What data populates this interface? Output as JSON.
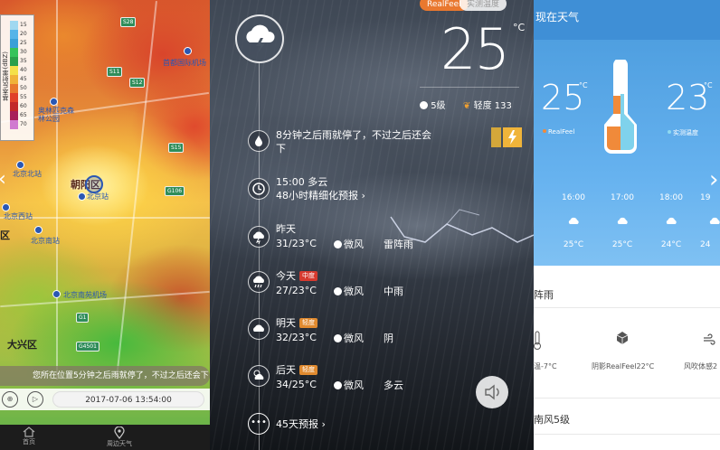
{
  "radar": {
    "legend_title": "基本反射率(dBZ)",
    "legend_values": [
      "15",
      "20",
      "25",
      "30",
      "35",
      "40",
      "45",
      "50",
      "55",
      "60",
      "65",
      "70"
    ],
    "legend_colors": [
      "#a0d8f0",
      "#55b4e8",
      "#3aa0d8",
      "#35c35a",
      "#2aa04a",
      "#f4e04a",
      "#f0b23a",
      "#e8782f",
      "#e0402a",
      "#c2282a",
      "#a8205a",
      "#d07ad0"
    ],
    "labels": {
      "chaoyang": "朝阳区",
      "beijing_north": "北京北站",
      "beijing_station": "北京站",
      "beijing_west": "北京西站",
      "beijing_south": "北京南站",
      "nanyuan": "北京南苑机场",
      "daxing": "大兴区",
      "olympic": "奥林匹克森林公园",
      "capital": "首都国际机场",
      "area_left": "区"
    },
    "roads": [
      "S28",
      "S11",
      "S12",
      "S15",
      "G1",
      "G106",
      "G4501"
    ],
    "message": "您所在位置5分钟之后雨就停了，不过之后还会下",
    "timestamp": "2017-07-06 13:54:00",
    "tabs": [
      "首页",
      "周边天气"
    ]
  },
  "forecast": {
    "realfeel_label": "RealFeel",
    "measured_label": "实测温度",
    "temperature": "25",
    "unit": "°C",
    "wind_level": "5级",
    "aqi_label": "轻度 133",
    "alert_text": "8分钟之后雨就停了，不过之后还会下",
    "hourly_time": "15:00  多云",
    "hourly_link": "48小时精细化预报",
    "days": [
      {
        "name": "昨天",
        "badge": "",
        "temps": "31/23°C",
        "wind": "微风",
        "cond": "雷阵雨"
      },
      {
        "name": "今天",
        "badge": "中度",
        "badge_color": "#d63a2f",
        "temps": "27/23°C",
        "wind": "微风",
        "cond": "中雨"
      },
      {
        "name": "明天",
        "badge": "轻度",
        "badge_color": "#e08a2f",
        "temps": "32/23°C",
        "wind": "微风",
        "cond": "阴"
      },
      {
        "name": "后天",
        "badge": "轻度",
        "badge_color": "#e08a2f",
        "temps": "34/25°C",
        "wind": "微风",
        "cond": "多云"
      }
    ],
    "days45_link": "45天预报"
  },
  "detail": {
    "header": "现在天气",
    "realfeel_temp": "25",
    "realfeel_label": "RealFeel",
    "measured_temp": "23",
    "measured_label": "实测温度",
    "deg": "°C",
    "hours": [
      {
        "time": "16:00",
        "temp": "25°C"
      },
      {
        "time": "17:00",
        "temp": "25°C"
      },
      {
        "time": "18:00",
        "temp": "24°C"
      },
      {
        "time": "19",
        "temp": "24"
      }
    ],
    "section_rain": "阵雨",
    "indices": [
      "温-7°C",
      "阴影RealFeel22°C",
      "风吹体感2"
    ],
    "section_wind": "南风5级"
  }
}
